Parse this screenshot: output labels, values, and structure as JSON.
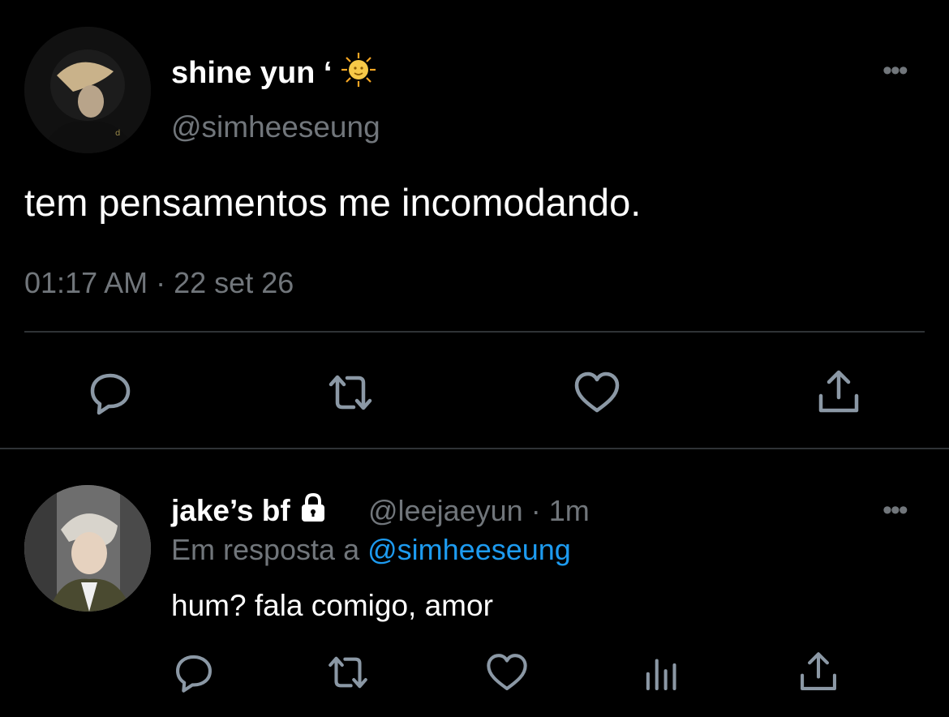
{
  "main_tweet": {
    "display_name": "shine yun ‘",
    "name_emoji": "sun-with-face-emoji",
    "handle": "@simheeseung",
    "text": "tem pensamentos me incomodando.",
    "time": "01:17 AM",
    "separator": "·",
    "date": "22 set 26",
    "actions": [
      "reply-icon",
      "retweet-icon",
      "like-icon",
      "share-icon"
    ]
  },
  "reply_tweet": {
    "display_name": "jake’s bf",
    "badge": "lock-icon",
    "handle": "@leejaeyun",
    "separator": "·",
    "time": "1m",
    "reply_prefix": "Em resposta a",
    "reply_mention": "@simheeseung",
    "text": "hum? fala comigo, amor",
    "actions": [
      "reply-icon",
      "retweet-icon",
      "like-icon",
      "analytics-icon",
      "share-icon"
    ]
  },
  "colors": {
    "background": "#000000",
    "primary_text": "#ffffff",
    "secondary_text": "#71767b",
    "divider": "#2f3336",
    "link": "#1d9bf0"
  }
}
